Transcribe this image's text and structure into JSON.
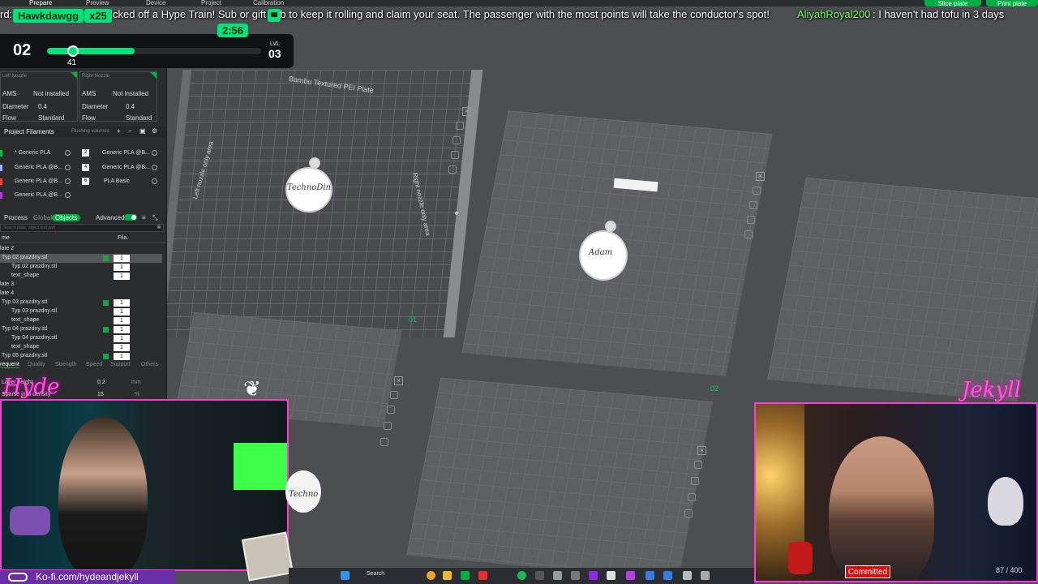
{
  "top_menu": {
    "prepare": "Prepare",
    "preview": "Preview",
    "device": "Device",
    "project": "Project",
    "calibration": "Calibration",
    "slice_plate": "Slice plate",
    "print_plate": "Print plate"
  },
  "ticker": {
    "part1": "rd:",
    "part2": "cked off a Hype Train! Sub or gift sub to keep it rolling and claim your seat. The passenger with the most points will take the conductor's spot!",
    "user": "AliyahRoyal200",
    "message": ": I haven't had tofu in 3 days"
  },
  "hype_train": {
    "conductor": "Hawkdawgg",
    "multiplier": "x25",
    "timer": "2:56",
    "current_level": "02",
    "progress_value": "41",
    "progress_percent": 41,
    "lvl_label": "LVL",
    "next_level": "03"
  },
  "nozzles": {
    "left_title": "Left Nozzle",
    "right_title": "Right Nozzle",
    "ams_label": "AMS",
    "ams_value": "Not installed",
    "diameter_label": "Diameter",
    "diameter_value": "0.4",
    "flow_label": "Flow",
    "flow_value": "Standard"
  },
  "filaments": {
    "header": "Project Filaments",
    "flushing": "Flushing volumes",
    "items": [
      {
        "label": "* Generic PLA",
        "color": "#00c040"
      },
      {
        "label": "Generic PLA @B...",
        "color": "#9bb0ff"
      },
      {
        "label": "Generic PLA @B...",
        "color": "#ff3a3a"
      },
      {
        "label": "Generic PLA @B...",
        "color": "#b03ae0"
      },
      {
        "label": "Generic PLA @B...",
        "color": "#f0f0f0"
      },
      {
        "label": "Generic PLA @B...",
        "color": "#444"
      },
      {
        "label": "PLA Basic",
        "color": "#333"
      }
    ],
    "nums": [
      "2",
      "4",
      "6"
    ]
  },
  "process": {
    "label": "Process",
    "global": "Global",
    "objects": "Objects",
    "advanced": "Advanced",
    "search_placeholder": "Search plate, object and part",
    "col_name": "me",
    "col_fila": "Fila."
  },
  "tree": [
    {
      "name": "late 2",
      "indent": 0,
      "count": "",
      "check": false,
      "sel": false
    },
    {
      "name": "Typ 02 prazdny.stl",
      "indent": 2,
      "count": "1",
      "check": true,
      "sel": true
    },
    {
      "name": "Typ 02 prazdny.stl",
      "indent": 14,
      "count": "1",
      "check": false,
      "sel": false
    },
    {
      "name": "text_shape",
      "indent": 14,
      "count": "1",
      "check": false,
      "sel": false
    },
    {
      "name": "late 3",
      "indent": 0,
      "count": "",
      "check": false,
      "sel": false
    },
    {
      "name": "late 4",
      "indent": 0,
      "count": "",
      "check": false,
      "sel": false
    },
    {
      "name": "Typ 03 prazdny.stl",
      "indent": 2,
      "count": "1",
      "check": true,
      "sel": false
    },
    {
      "name": "Typ 03 prazdny.stl",
      "indent": 14,
      "count": "1",
      "check": false,
      "sel": false
    },
    {
      "name": "text_shape",
      "indent": 14,
      "count": "1",
      "check": false,
      "sel": false
    },
    {
      "name": "Typ 04 prazdny.stl",
      "indent": 2,
      "count": "1",
      "check": true,
      "sel": false
    },
    {
      "name": "Typ 04 prazdny.stl",
      "indent": 14,
      "count": "1",
      "check": false,
      "sel": false
    },
    {
      "name": "text_shape",
      "indent": 14,
      "count": "1",
      "check": false,
      "sel": false
    },
    {
      "name": "Typ 05 prazdny.stl",
      "indent": 2,
      "count": "1",
      "check": true,
      "sel": false
    }
  ],
  "quality_tabs": [
    "requent",
    "Quality",
    "Strength",
    "Speed",
    "Support",
    "Others"
  ],
  "params": {
    "layer_height_label": "Layer height",
    "layer_height_value": "0.2",
    "layer_height_unit": "mm",
    "sparse_label": "Sparse infill density",
    "sparse_value": "15",
    "sparse_unit": "%"
  },
  "workspace": {
    "bed_label": "Bambu Textured PEI Plate",
    "left_area": "Left nozzle only area",
    "right_area": "Right nozzle only area",
    "plate1_tag": "01",
    "plate2_tag": "02",
    "ornament_a_text": "TechnoDin",
    "ornament_b_text": "Adam",
    "ornament_c_text": "Techno"
  },
  "overlay": {
    "left_cam_title": "Hyde",
    "right_cam_title": "Jekyll",
    "kofi": "Ko-fi.com/hydeandjekyll",
    "taskbar_search": "Search",
    "committed": "Committed",
    "progress": "87 / 400"
  }
}
